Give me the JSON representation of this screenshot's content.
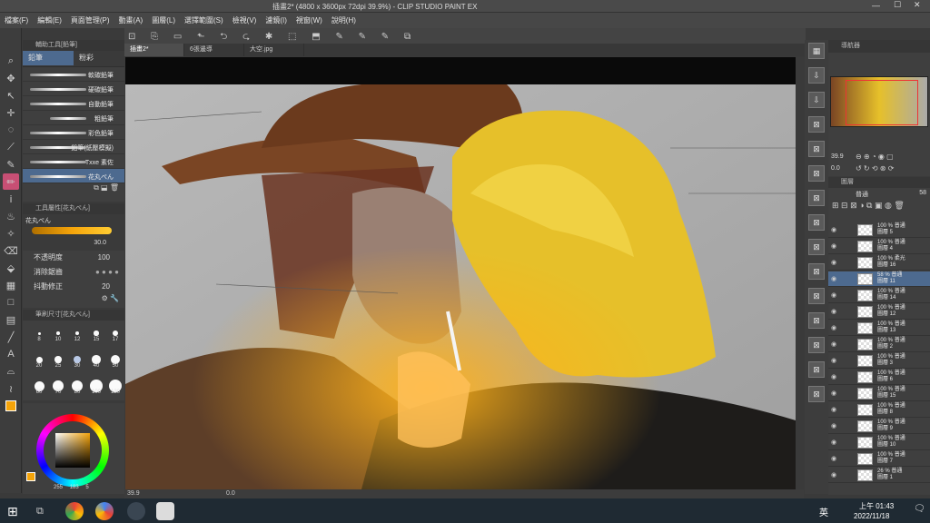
{
  "window": {
    "title": "插畫2* (4800 x 3600px 72dpi 39.9%) - CLIP STUDIO PAINT EX"
  },
  "menu": [
    "檔案(F)",
    "編輯(E)",
    "頁面管理(P)",
    "動畫(A)",
    "圖層(L)",
    "選擇範圍(S)",
    "檢視(V)",
    "濾鏡(I)",
    "視窗(W)",
    "說明(H)"
  ],
  "subtool": {
    "header": "輔助工具[鉛筆]",
    "tabs": [
      "鉛筆",
      "粉彩"
    ],
    "brushes": [
      "軟碳鉛筆",
      "硬碳鉛筆",
      "自動鉛筆",
      "粗鉛筆",
      "彩色鉛筆",
      "鉛筆(紙壓模擬)",
      "Txxe 素佐",
      "花丸ぺん"
    ]
  },
  "toolprop": {
    "header": "工具屬性[花丸ぺん]",
    "brush_name": "花丸ぺん",
    "size_value": "30.0",
    "opacity_label": "不透明度",
    "opacity_value": "100",
    "aa_label": "消除鋸齒",
    "stab_label": "抖動修正",
    "stab_value": "20"
  },
  "brushsize": {
    "header": "筆刷尺寸[花丸ぺん]",
    "sizes": [
      "8",
      "10",
      "12",
      "15",
      "17",
      "20",
      "25",
      "30",
      "40",
      "50",
      "60",
      "70",
      "80",
      "100",
      "120"
    ]
  },
  "color": {
    "r": "255",
    "g": "183",
    "b": "5",
    "main": "#f5a40a"
  },
  "doctabs": [
    "插畫2*",
    "6張邊導",
    "大空.jpg"
  ],
  "status": {
    "zoom": "39.9",
    "angle": "0.0"
  },
  "navigator": {
    "header": "導航器",
    "zoom": "39.9",
    "angle": "0.0"
  },
  "layers": {
    "header": "圖層",
    "blend": "普通",
    "opacity": "58",
    "rows": [
      {
        "pct": "100 %",
        "mode": "普通",
        "name": "圖層 5"
      },
      {
        "pct": "100 %",
        "mode": "普通",
        "name": "圖層 4"
      },
      {
        "pct": "100 %",
        "mode": "柔光",
        "name": "圖層 16"
      },
      {
        "pct": "58 %",
        "mode": "普通",
        "name": "圖層 11"
      },
      {
        "pct": "100 %",
        "mode": "普通",
        "name": "圖層 14"
      },
      {
        "pct": "100 %",
        "mode": "普通",
        "name": "圖層 12"
      },
      {
        "pct": "100 %",
        "mode": "普通",
        "name": "圖層 13"
      },
      {
        "pct": "100 %",
        "mode": "普通",
        "name": "圖層 2"
      },
      {
        "pct": "100 %",
        "mode": "普通",
        "name": "圖層 3"
      },
      {
        "pct": "100 %",
        "mode": "普通",
        "name": "圖層 6"
      },
      {
        "pct": "100 %",
        "mode": "普通",
        "name": "圖層 15"
      },
      {
        "pct": "100 %",
        "mode": "普通",
        "name": "圖層 8"
      },
      {
        "pct": "100 %",
        "mode": "普通",
        "name": "圖層 9"
      },
      {
        "pct": "100 %",
        "mode": "普通",
        "name": "圖層 10"
      },
      {
        "pct": "100 %",
        "mode": "普通",
        "name": "圖層 7"
      },
      {
        "pct": "26 %",
        "mode": "普通",
        "name": "圖層 1"
      }
    ]
  },
  "taskbar": {
    "time": "上午 01:43",
    "date": "2022/11/18",
    "ime": "英"
  }
}
